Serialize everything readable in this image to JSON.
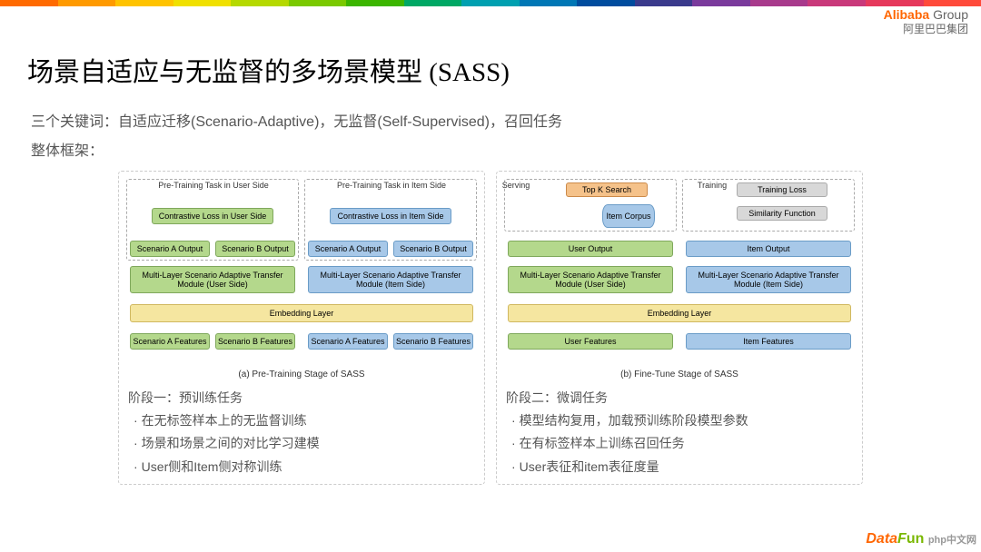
{
  "colors": [
    "#ff6a00",
    "#ff9a00",
    "#ffc300",
    "#f0e000",
    "#b5d900",
    "#7ac900",
    "#3cb500",
    "#00a865",
    "#00a0b0",
    "#0077b5",
    "#004c9e",
    "#3a3a8c",
    "#7a3a9c",
    "#a83a8c",
    "#c9397a",
    "#e6395c",
    "#ff4a3a"
  ],
  "logo": {
    "brand_a": "Alibaba",
    "brand_b": "Group",
    "cn": "阿里巴巴集团"
  },
  "title": "场景自适应与无监督的多场景模型 (SASS)",
  "sub1": "三个关键词：自适应迁移(Scenario-Adaptive)，无监督(Self-Supervised)，召回任务",
  "sub2": "整体框架：",
  "diagA": {
    "task_user": "Pre-Training Task in User Side",
    "task_item": "Pre-Training Task in Item Side",
    "cl_user": "Contrastive Loss in User Side",
    "cl_item": "Contrastive Loss in Item Side",
    "sa_out": "Scenario A  Output",
    "sb_out": "Scenario B Output",
    "ml_user": "Multi-Layer Scenario Adaptive Transfer Module (User Side)",
    "ml_item": "Multi-Layer Scenario Adaptive Transfer Module (Item Side)",
    "emb": "Embedding Layer",
    "sa_feat": "Scenario A Features",
    "sb_feat": "Scenario B Features",
    "caption": "(a) Pre-Training Stage of SASS"
  },
  "diagB": {
    "serving": "Serving",
    "training": "Training",
    "topk": "Top K Search",
    "corpus": "Item Corpus",
    "tloss": "Training Loss",
    "sim": "Similarity Function",
    "uo": "User Output",
    "io": "Item Output",
    "ml_user": "Multi-Layer Scenario Adaptive Transfer Module (User Side)",
    "ml_item": "Multi-Layer Scenario Adaptive Transfer Module (Item Side)",
    "emb": "Embedding Layer",
    "uf": "User Features",
    "if": "Item Features",
    "caption": "(b) Fine-Tune Stage of SASS"
  },
  "stageA": {
    "h": "阶段一：预训练任务",
    "b1": "在无标签样本上的无监督训练",
    "b2": "场景和场景之间的对比学习建模",
    "b3": "User侧和Item侧对称训练"
  },
  "stageB": {
    "h": "阶段二：微调任务",
    "b1": "模型结构复用，加载预训练阶段模型参数",
    "b2": "在有标签样本上训练召回任务",
    "b3": "User表征和item表征度量"
  },
  "wm": {
    "d": "D",
    "ata": "ata",
    "f": "F",
    "un": "un",
    "php": "php中文网"
  }
}
